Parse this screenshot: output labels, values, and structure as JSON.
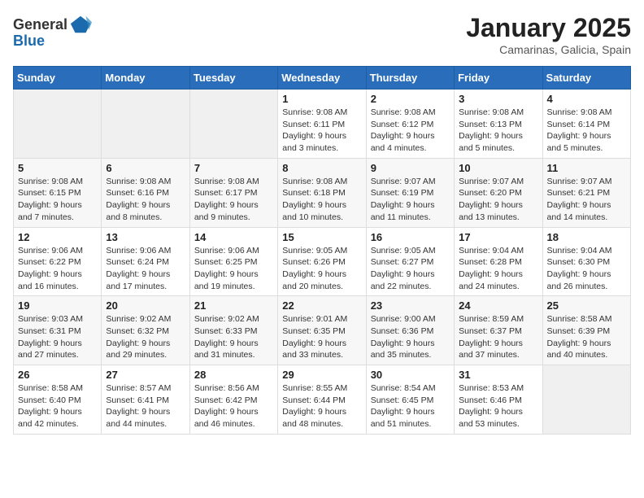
{
  "header": {
    "logo_general": "General",
    "logo_blue": "Blue",
    "month_title": "January 2025",
    "subtitle": "Camarinas, Galicia, Spain"
  },
  "weekdays": [
    "Sunday",
    "Monday",
    "Tuesday",
    "Wednesday",
    "Thursday",
    "Friday",
    "Saturday"
  ],
  "weeks": [
    [
      {
        "day": "",
        "info": ""
      },
      {
        "day": "",
        "info": ""
      },
      {
        "day": "",
        "info": ""
      },
      {
        "day": "1",
        "info": "Sunrise: 9:08 AM\nSunset: 6:11 PM\nDaylight: 9 hours and 3 minutes."
      },
      {
        "day": "2",
        "info": "Sunrise: 9:08 AM\nSunset: 6:12 PM\nDaylight: 9 hours and 4 minutes."
      },
      {
        "day": "3",
        "info": "Sunrise: 9:08 AM\nSunset: 6:13 PM\nDaylight: 9 hours and 5 minutes."
      },
      {
        "day": "4",
        "info": "Sunrise: 9:08 AM\nSunset: 6:14 PM\nDaylight: 9 hours and 5 minutes."
      }
    ],
    [
      {
        "day": "5",
        "info": "Sunrise: 9:08 AM\nSunset: 6:15 PM\nDaylight: 9 hours and 7 minutes."
      },
      {
        "day": "6",
        "info": "Sunrise: 9:08 AM\nSunset: 6:16 PM\nDaylight: 9 hours and 8 minutes."
      },
      {
        "day": "7",
        "info": "Sunrise: 9:08 AM\nSunset: 6:17 PM\nDaylight: 9 hours and 9 minutes."
      },
      {
        "day": "8",
        "info": "Sunrise: 9:08 AM\nSunset: 6:18 PM\nDaylight: 9 hours and 10 minutes."
      },
      {
        "day": "9",
        "info": "Sunrise: 9:07 AM\nSunset: 6:19 PM\nDaylight: 9 hours and 11 minutes."
      },
      {
        "day": "10",
        "info": "Sunrise: 9:07 AM\nSunset: 6:20 PM\nDaylight: 9 hours and 13 minutes."
      },
      {
        "day": "11",
        "info": "Sunrise: 9:07 AM\nSunset: 6:21 PM\nDaylight: 9 hours and 14 minutes."
      }
    ],
    [
      {
        "day": "12",
        "info": "Sunrise: 9:06 AM\nSunset: 6:22 PM\nDaylight: 9 hours and 16 minutes."
      },
      {
        "day": "13",
        "info": "Sunrise: 9:06 AM\nSunset: 6:24 PM\nDaylight: 9 hours and 17 minutes."
      },
      {
        "day": "14",
        "info": "Sunrise: 9:06 AM\nSunset: 6:25 PM\nDaylight: 9 hours and 19 minutes."
      },
      {
        "day": "15",
        "info": "Sunrise: 9:05 AM\nSunset: 6:26 PM\nDaylight: 9 hours and 20 minutes."
      },
      {
        "day": "16",
        "info": "Sunrise: 9:05 AM\nSunset: 6:27 PM\nDaylight: 9 hours and 22 minutes."
      },
      {
        "day": "17",
        "info": "Sunrise: 9:04 AM\nSunset: 6:28 PM\nDaylight: 9 hours and 24 minutes."
      },
      {
        "day": "18",
        "info": "Sunrise: 9:04 AM\nSunset: 6:30 PM\nDaylight: 9 hours and 26 minutes."
      }
    ],
    [
      {
        "day": "19",
        "info": "Sunrise: 9:03 AM\nSunset: 6:31 PM\nDaylight: 9 hours and 27 minutes."
      },
      {
        "day": "20",
        "info": "Sunrise: 9:02 AM\nSunset: 6:32 PM\nDaylight: 9 hours and 29 minutes."
      },
      {
        "day": "21",
        "info": "Sunrise: 9:02 AM\nSunset: 6:33 PM\nDaylight: 9 hours and 31 minutes."
      },
      {
        "day": "22",
        "info": "Sunrise: 9:01 AM\nSunset: 6:35 PM\nDaylight: 9 hours and 33 minutes."
      },
      {
        "day": "23",
        "info": "Sunrise: 9:00 AM\nSunset: 6:36 PM\nDaylight: 9 hours and 35 minutes."
      },
      {
        "day": "24",
        "info": "Sunrise: 8:59 AM\nSunset: 6:37 PM\nDaylight: 9 hours and 37 minutes."
      },
      {
        "day": "25",
        "info": "Sunrise: 8:58 AM\nSunset: 6:39 PM\nDaylight: 9 hours and 40 minutes."
      }
    ],
    [
      {
        "day": "26",
        "info": "Sunrise: 8:58 AM\nSunset: 6:40 PM\nDaylight: 9 hours and 42 minutes."
      },
      {
        "day": "27",
        "info": "Sunrise: 8:57 AM\nSunset: 6:41 PM\nDaylight: 9 hours and 44 minutes."
      },
      {
        "day": "28",
        "info": "Sunrise: 8:56 AM\nSunset: 6:42 PM\nDaylight: 9 hours and 46 minutes."
      },
      {
        "day": "29",
        "info": "Sunrise: 8:55 AM\nSunset: 6:44 PM\nDaylight: 9 hours and 48 minutes."
      },
      {
        "day": "30",
        "info": "Sunrise: 8:54 AM\nSunset: 6:45 PM\nDaylight: 9 hours and 51 minutes."
      },
      {
        "day": "31",
        "info": "Sunrise: 8:53 AM\nSunset: 6:46 PM\nDaylight: 9 hours and 53 minutes."
      },
      {
        "day": "",
        "info": ""
      }
    ]
  ]
}
